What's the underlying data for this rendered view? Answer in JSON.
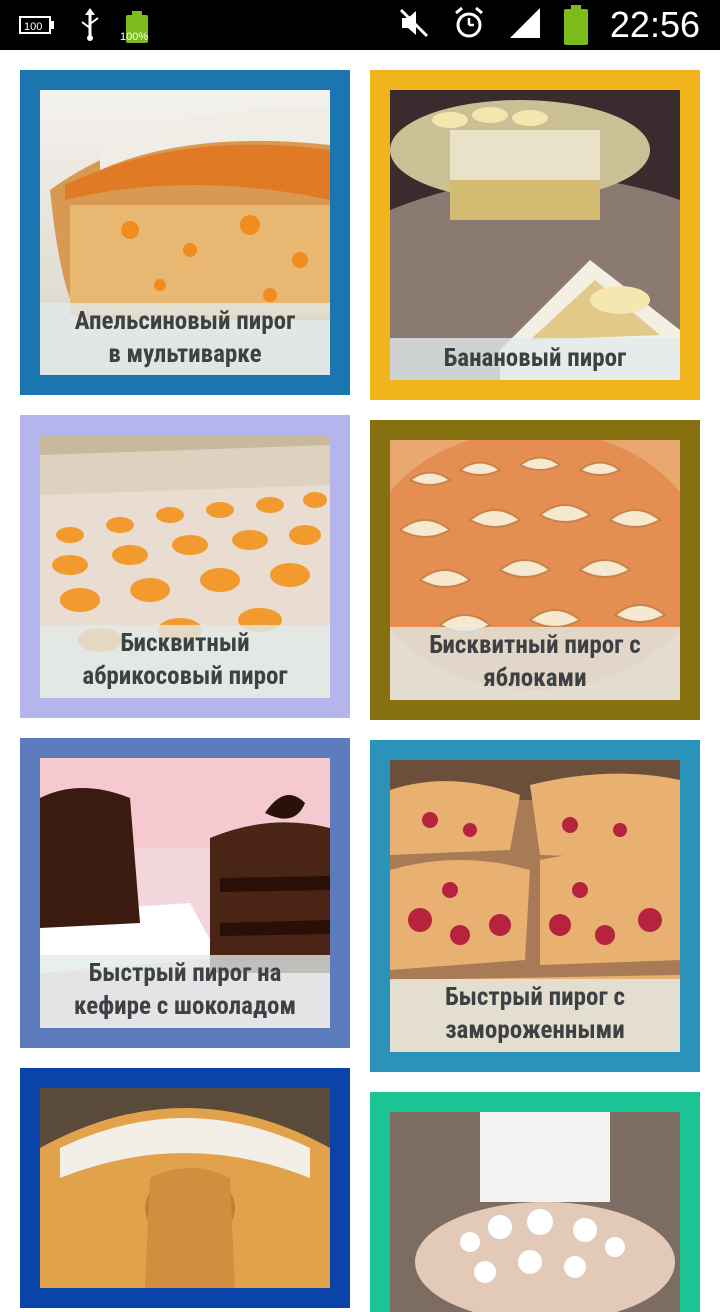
{
  "status_bar": {
    "time": "22:56",
    "battery_small_label": "100%",
    "icons": [
      "battery-100-icon",
      "usb-icon",
      "battery-charging-icon",
      "mute-icon",
      "alarm-icon",
      "signal-icon",
      "battery-icon"
    ]
  },
  "recipes": [
    {
      "title": [
        "Апельсиновый пирог",
        "в мультиварке"
      ],
      "frame_color": "#1b76b0"
    },
    {
      "title": [
        "Банановый пирог"
      ],
      "frame_color": "#f0b41c"
    },
    {
      "title": [
        "Бисквитный",
        "абрикосовый пирог"
      ],
      "frame_color": "#b4b5ec"
    },
    {
      "title": [
        "Бисквитный пирог с",
        "яблоками"
      ],
      "frame_color": "#86700f"
    },
    {
      "title": [
        "Быстрый пирог на",
        "кефире с шоколадом"
      ],
      "frame_color": "#5b7bbd"
    },
    {
      "title": [
        "Быстрый пирог с",
        "замороженными"
      ],
      "frame_color": "#2b93b9"
    },
    {
      "title": [],
      "frame_color": "#0a44a8"
    },
    {
      "title": [],
      "frame_color": "#1cc495"
    }
  ]
}
